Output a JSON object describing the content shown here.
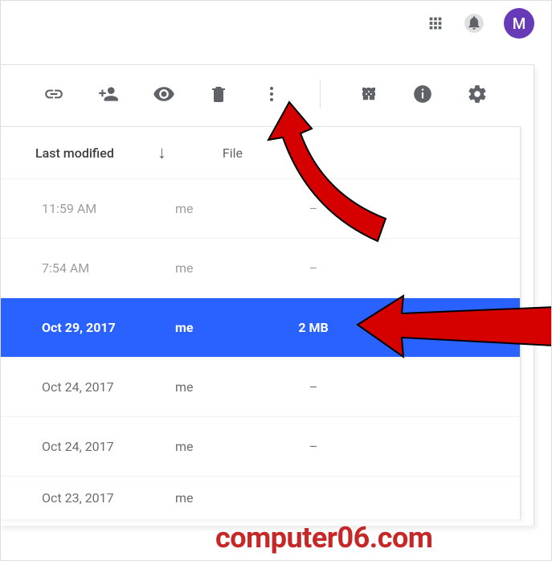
{
  "header": {
    "avatar_initial": "M"
  },
  "toolbar": {
    "icons": {
      "link": "link-icon",
      "add_person": "add-person-icon",
      "preview": "preview-icon",
      "remove": "remove-icon",
      "more": "more-icon",
      "grid_view": "grid-view-icon",
      "details": "details-icon",
      "settings": "settings-icon"
    }
  },
  "columns": {
    "sort_label": "Last modified",
    "file_size_label": "File"
  },
  "rows": [
    {
      "date": "11:59 AM",
      "owner": "me",
      "size": "–",
      "selected": false,
      "tone": "light"
    },
    {
      "date": "7:54 AM",
      "owner": "me",
      "size": "–",
      "selected": false,
      "tone": "light"
    },
    {
      "date": "Oct 29, 2017",
      "owner": "me",
      "size": "2 MB",
      "selected": true,
      "tone": "sel"
    },
    {
      "date": "Oct 24, 2017",
      "owner": "me",
      "size": "–",
      "selected": false,
      "tone": "med"
    },
    {
      "date": "Oct 24, 2017",
      "owner": "me",
      "size": "–",
      "selected": false,
      "tone": "med"
    },
    {
      "date": "Oct 23, 2017",
      "owner": "me",
      "size": "",
      "selected": false,
      "tone": "med"
    }
  ],
  "watermark": "computer06.com"
}
